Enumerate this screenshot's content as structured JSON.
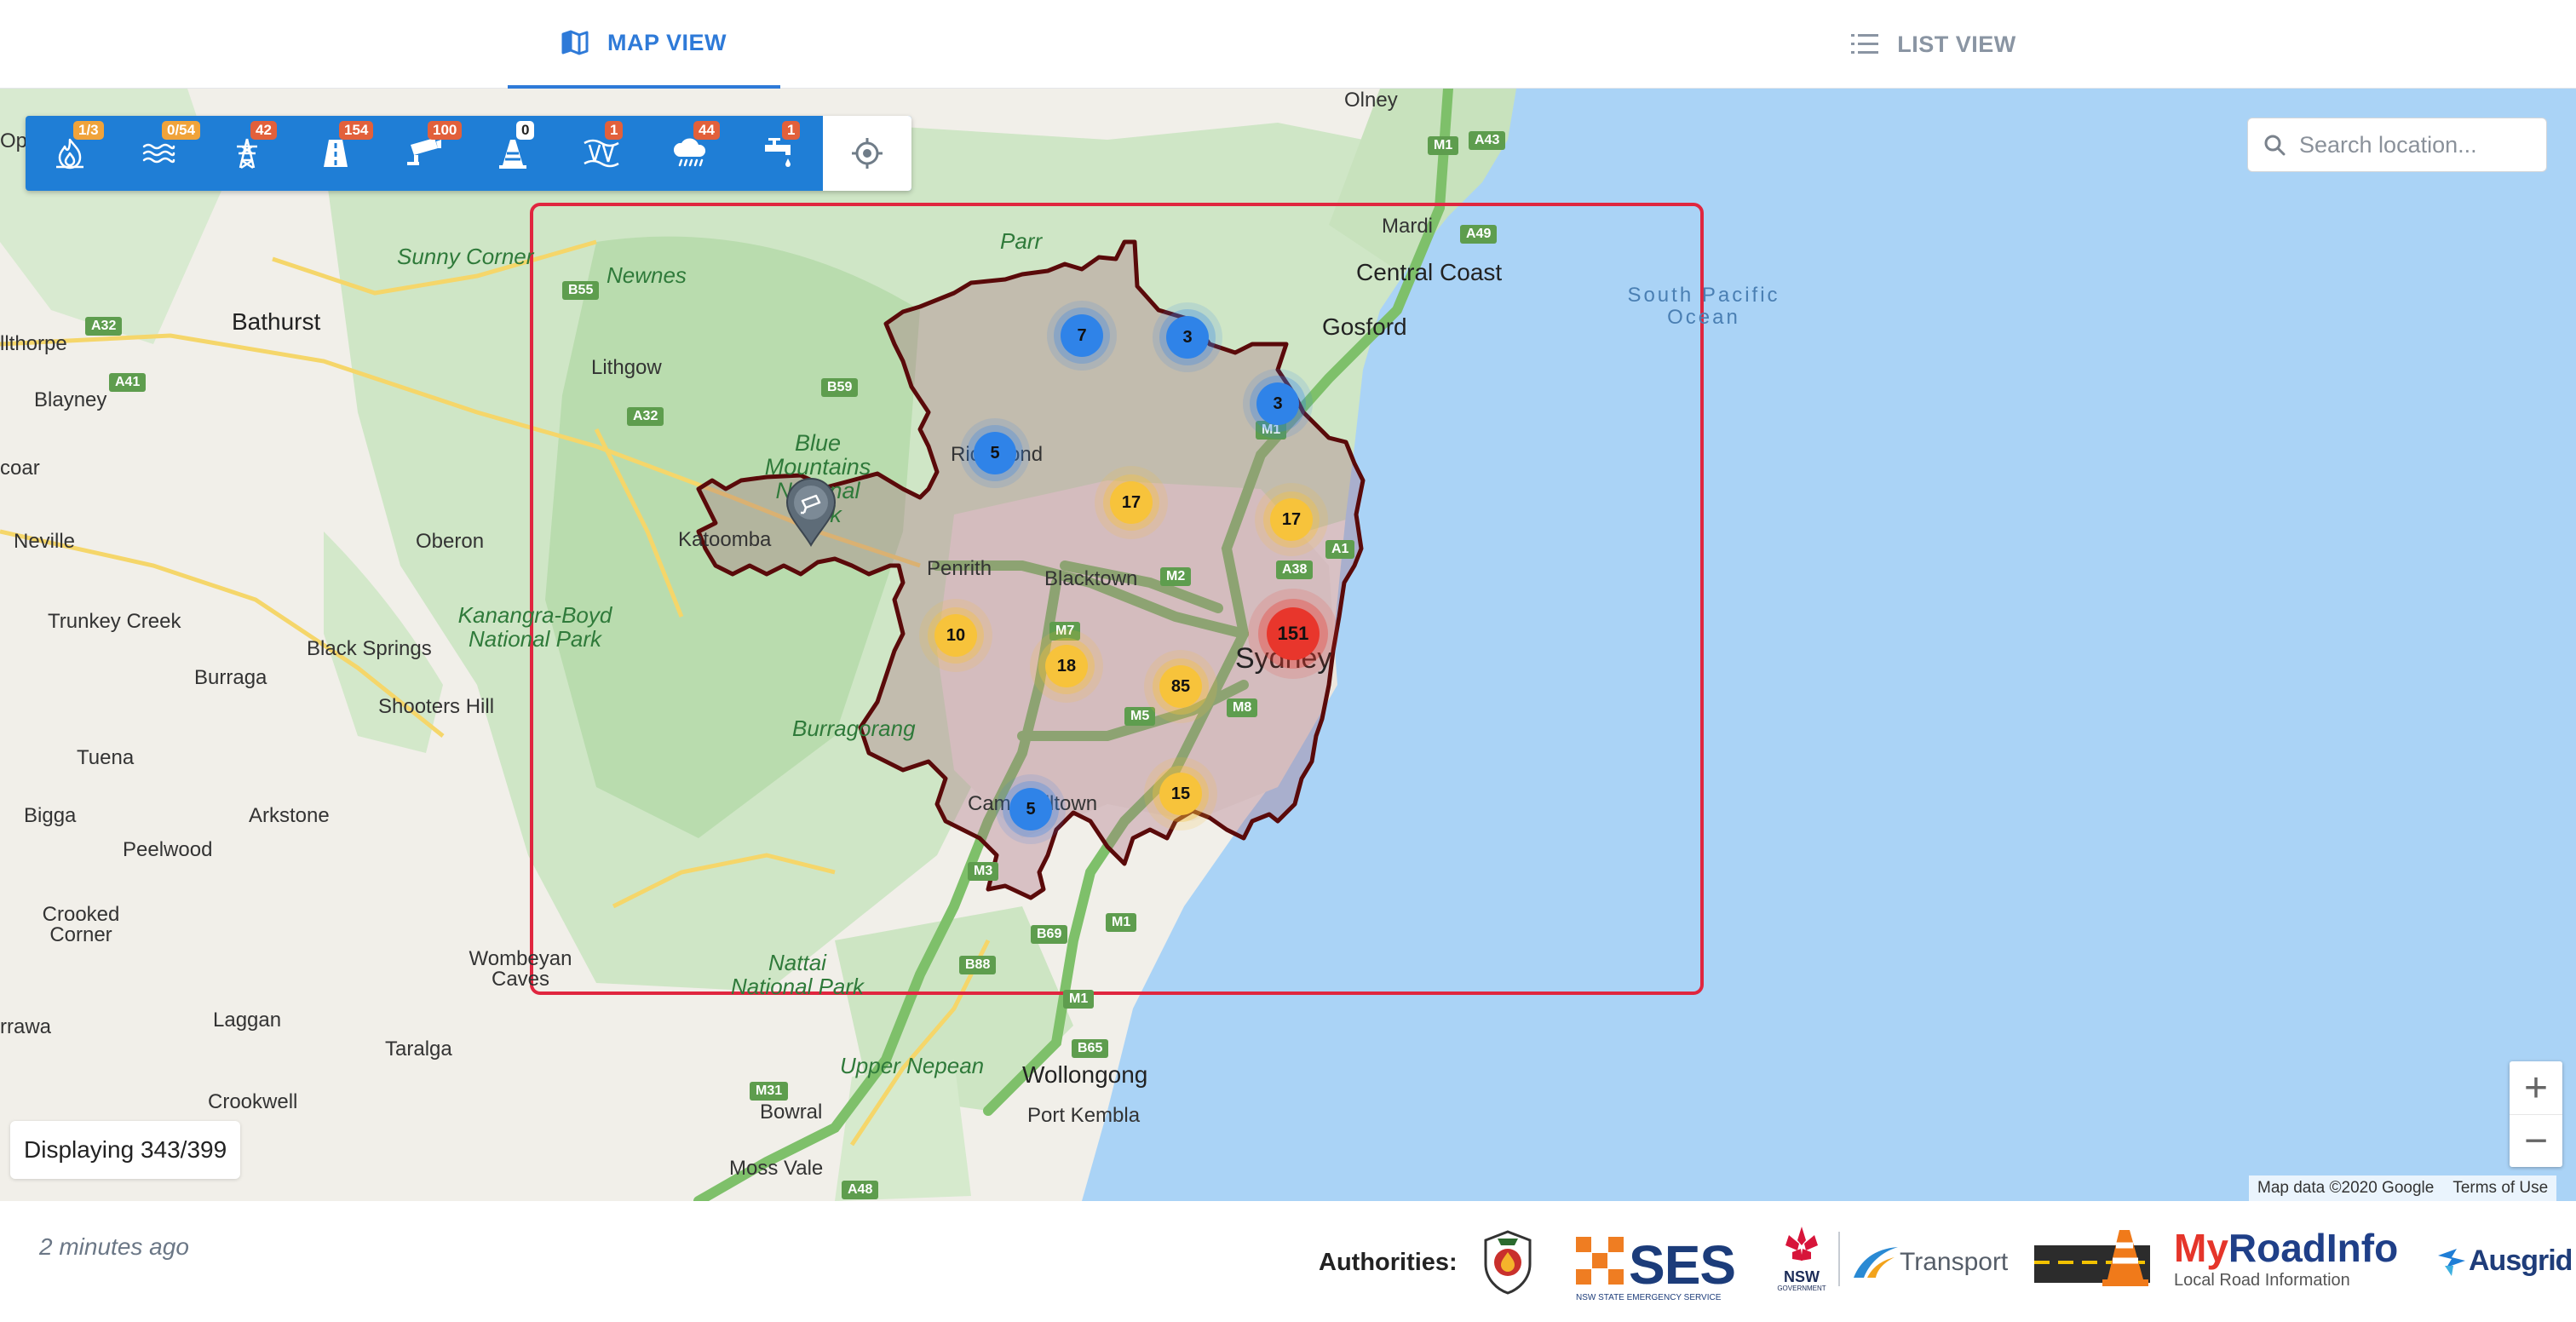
{
  "tabs": {
    "map_view": "MAP VIEW",
    "list_view": "LIST VIEW"
  },
  "filters": [
    {
      "icon": "bushfire-icon",
      "badge": "1/3",
      "badge_color": "#f0a33a"
    },
    {
      "icon": "flood-icon",
      "badge": "0/54",
      "badge_color": "#f0a33a"
    },
    {
      "icon": "power-outage-icon",
      "badge": "42",
      "badge_color": "#e2603b"
    },
    {
      "icon": "road-closure-icon",
      "badge": "154",
      "badge_color": "#e2603b"
    },
    {
      "icon": "traffic-camera-icon",
      "badge": "100",
      "badge_color": "#e2603b"
    },
    {
      "icon": "roadwork-cone-icon",
      "badge": "0",
      "badge_color": "#ffffff"
    },
    {
      "icon": "tsunami-icon",
      "badge": "1",
      "badge_color": "#e2603b"
    },
    {
      "icon": "weather-warning-icon",
      "badge": "44",
      "badge_color": "#e2603b"
    },
    {
      "icon": "water-outage-icon",
      "badge": "1",
      "badge_color": "#e2603b"
    }
  ],
  "search": {
    "placeholder": "Search location..."
  },
  "clusters": [
    {
      "count": "7",
      "level": "blue"
    },
    {
      "count": "3",
      "level": "blue"
    },
    {
      "count": "3",
      "level": "blue"
    },
    {
      "count": "5",
      "level": "blue"
    },
    {
      "count": "17",
      "level": "amber"
    },
    {
      "count": "17",
      "level": "amber"
    },
    {
      "count": "151",
      "level": "red"
    },
    {
      "count": "10",
      "level": "amber"
    },
    {
      "count": "18",
      "level": "amber"
    },
    {
      "count": "85",
      "level": "amber"
    },
    {
      "count": "15",
      "level": "amber"
    },
    {
      "count": "5",
      "level": "blue"
    }
  ],
  "map_labels": {
    "sunny_corner": "Sunny Corner",
    "bathurst": "Bathurst",
    "llthorpe": "llthorpe",
    "blayney": "Blayney",
    "coar": "coar",
    "neville": "Neville",
    "oberon": "Oberon",
    "trunkey_creek": "Trunkey Creek",
    "kanangra_boyd": "Kanangra-Boyd National Park",
    "black_springs": "Black Springs",
    "burraga": "Burraga",
    "shooters_hill": "Shooters Hill",
    "tuena": "Tuena",
    "bigga": "Bigga",
    "arkstone": "Arkstone",
    "peelwood": "Peelwood",
    "crooked_corner": "Crooked Corner",
    "wombeyan_caves": "Wombeyan Caves",
    "laggan": "Laggan",
    "taralga": "Taralga",
    "rrawa": "rrawa",
    "crookwell": "Crookwell",
    "newnes": "Newnes",
    "lithgow": "Lithgow",
    "parr": "Parr",
    "mardi": "Mardi",
    "central_coast": "Central Coast",
    "gosford": "Gosford",
    "south_pacific_ocean": "South Pacific Ocean",
    "blue_mountains": "Blue Mountains National Park",
    "katoomba": "Katoomba",
    "richmond": "Richmond",
    "penrith": "Penrith",
    "blacktown": "Blacktown",
    "sydney": "Sydney",
    "burragorang": "Burragorang",
    "campbelltown": "Campbelltown",
    "nattai": "Nattai National Park",
    "upper_nepean": "Upper Nepean",
    "wollongong": "Wollongong",
    "port_kembla": "Port Kembla",
    "bowral": "Bowral",
    "moss_vale": "Moss Vale",
    "olney": "Olney",
    "opi": "Opi"
  },
  "road_shields": [
    "M1",
    "A43",
    "A49",
    "B55",
    "A32",
    "A41",
    "B59",
    "A32",
    "M1",
    "A38",
    "M2",
    "M7",
    "M5",
    "M8",
    "M3",
    "B69",
    "M1",
    "B88",
    "M1",
    "B65",
    "M31",
    "A48",
    "A1"
  ],
  "zoom": {
    "in": "+",
    "out": "−"
  },
  "attribution": {
    "map_data": "Map data ©2020 Google",
    "terms": "Terms of Use"
  },
  "status": {
    "displaying": "Displaying 343/399"
  },
  "footer": {
    "updated": "2 minutes ago",
    "authorities_label": "Authorities:",
    "ses": "SES",
    "ses_sub": "NSW STATE EMERGENCY SERVICE",
    "nsw": "NSW",
    "nsw_sub": "GOVERNMENT",
    "transport": "Transport",
    "myroadinfo_my": "My",
    "myroadinfo_road": "RoadInfo",
    "myroadinfo_sub": "Local Road Information",
    "ausgrid": "Ausgrid"
  },
  "colors": {
    "accent": "#2e7ad8",
    "toolbar": "#1f7ed6",
    "boundary_box": "#e0263f",
    "lga_outline": "#5a0a0a",
    "cluster_blue": "#2f83e8",
    "cluster_amber": "#f7c33b",
    "cluster_red": "#e8362c",
    "ocean": "#aad3f6"
  }
}
